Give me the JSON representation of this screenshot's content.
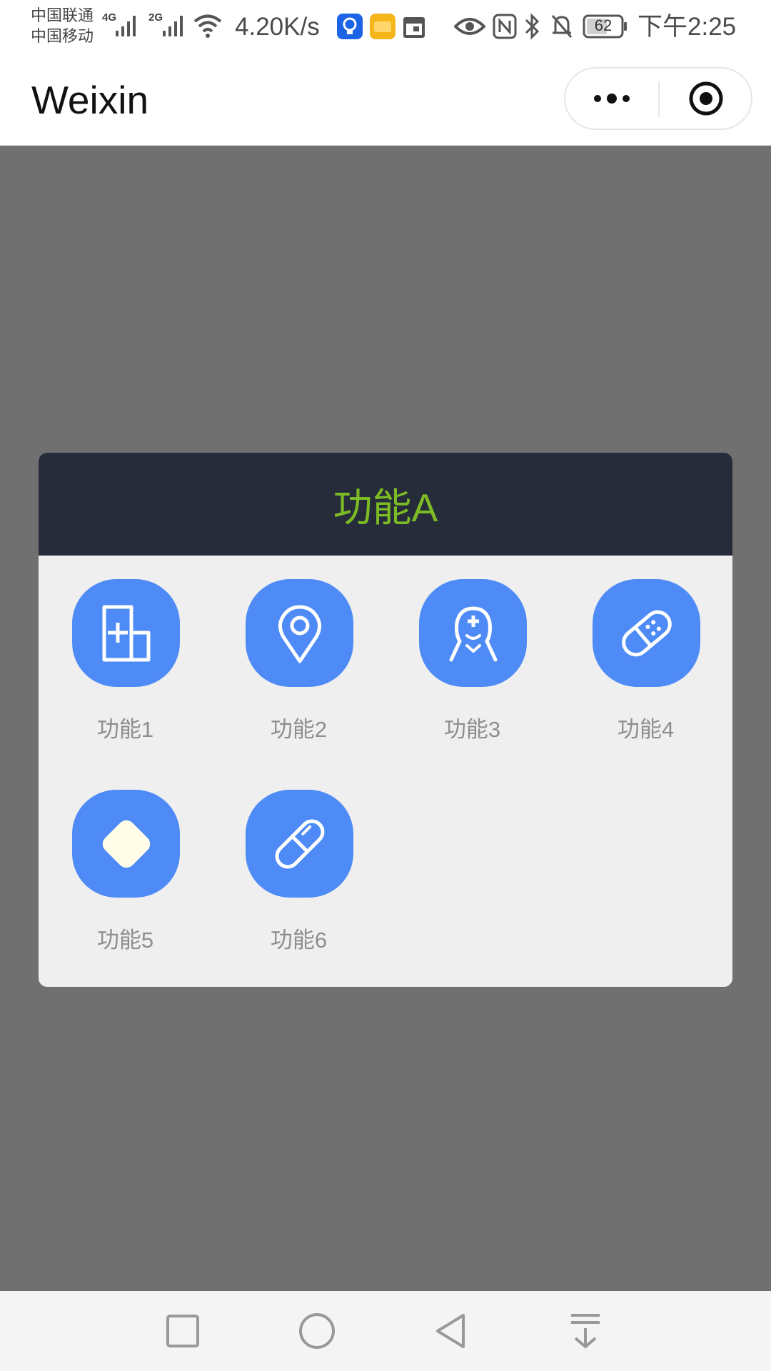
{
  "status_bar": {
    "carrier_1": "中国联通",
    "carrier_2": "中国移动",
    "network_1": "4G",
    "network_2": "2G",
    "speed": "4.20K/s",
    "battery": "62",
    "time": "下午2:25"
  },
  "title_bar": {
    "title": "Weixin",
    "more_icon": "more-dots-icon",
    "close_icon": "target-circle-icon"
  },
  "dialog": {
    "title": "功能A",
    "items": [
      {
        "label": "功能1",
        "icon": "add-document-icon"
      },
      {
        "label": "功能2",
        "icon": "location-pin-icon"
      },
      {
        "label": "功能3",
        "icon": "doctor-face-icon"
      },
      {
        "label": "功能4",
        "icon": "bandage-icon"
      },
      {
        "label": "功能5",
        "icon": "diamond-icon"
      },
      {
        "label": "功能6",
        "icon": "pill-icon"
      }
    ]
  },
  "colors": {
    "overlay": "#707070",
    "dialog_header": "#262c3a",
    "title_green": "#7dbb25",
    "tile_blue": "#4e8bf6",
    "diamond_fill": "#fffde8"
  },
  "nav_bar": {
    "icons": [
      "square-icon",
      "circle-home-icon",
      "triangle-back-icon",
      "notification-down-icon"
    ]
  }
}
